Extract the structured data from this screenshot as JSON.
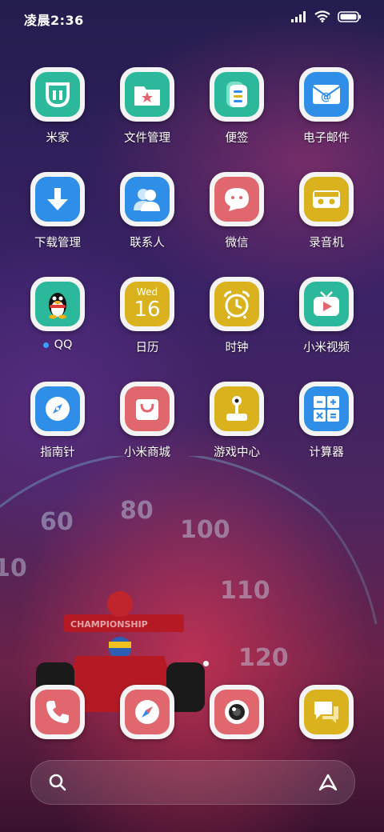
{
  "status_bar": {
    "time": "凌晨2:36",
    "icons": [
      "signal-icon",
      "wifi-icon",
      "battery-icon"
    ]
  },
  "apps": [
    {
      "label": "米家",
      "icon": "mi-home-icon",
      "color": "#2bb89b"
    },
    {
      "label": "文件管理",
      "icon": "folder-icon",
      "color": "#2bb89b"
    },
    {
      "label": "便签",
      "icon": "notes-icon",
      "color": "#2bb89b"
    },
    {
      "label": "电子邮件",
      "icon": "mail-icon",
      "color": "#2f8fe8"
    },
    {
      "label": "下载管理",
      "icon": "download-icon",
      "color": "#2f8fe8"
    },
    {
      "label": "联系人",
      "icon": "contacts-icon",
      "color": "#2f8fe8"
    },
    {
      "label": "微信",
      "icon": "chat-bubble-icon",
      "color": "#e0676e"
    },
    {
      "label": "录音机",
      "icon": "recorder-icon",
      "color": "#d9b21e"
    },
    {
      "label": "QQ",
      "icon": "penguin-icon",
      "color": "#2bb89b"
    },
    {
      "label": "日历",
      "icon": "calendar-icon",
      "color": "#d9b21e",
      "weekday": "Wed",
      "day": "16"
    },
    {
      "label": "时钟",
      "icon": "alarm-clock-icon",
      "color": "#d9b21e"
    },
    {
      "label": "小米视频",
      "icon": "tv-play-icon",
      "color": "#2bb89b"
    },
    {
      "label": "指南针",
      "icon": "compass-icon",
      "color": "#2f8fe8"
    },
    {
      "label": "小米商城",
      "icon": "shopping-bag-icon",
      "color": "#e0676e"
    },
    {
      "label": "游戏中心",
      "icon": "joystick-icon",
      "color": "#d9b21e"
    },
    {
      "label": "计算器",
      "icon": "calculator-icon",
      "color": "#2f8fe8"
    }
  ],
  "dock": [
    {
      "name": "phone",
      "icon": "phone-icon",
      "color": "#e0676e"
    },
    {
      "name": "browser",
      "icon": "browser-compass-icon",
      "color": "#e0676e"
    },
    {
      "name": "camera",
      "icon": "camera-icon",
      "color": "#e0676e"
    },
    {
      "name": "messages",
      "icon": "message-icon",
      "color": "#d9b21e"
    }
  ],
  "wallpaper": {
    "speedometer_labels": [
      "10",
      "60",
      "80",
      "100",
      "110",
      "120"
    ],
    "car_text": "CHAMPIONSHIP"
  },
  "search_bar": {
    "icons": [
      "search-icon",
      "assistant-icon"
    ]
  }
}
